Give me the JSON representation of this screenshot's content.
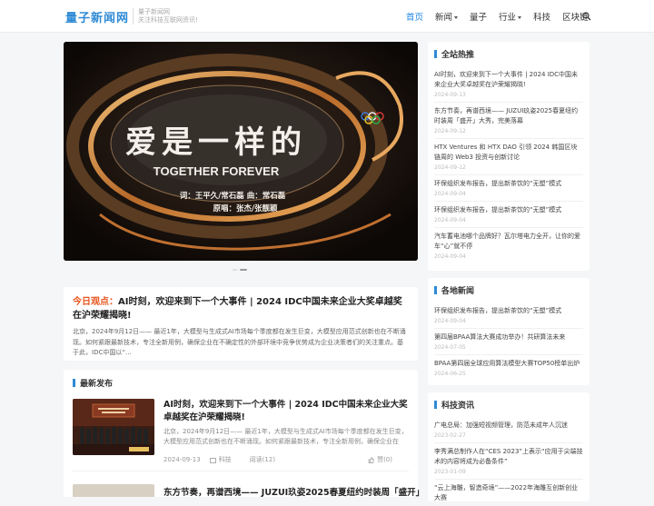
{
  "header": {
    "logo": "量子新闻网",
    "tagline_1": "量子新闻网",
    "tagline_2": "关注科技互联网资讯!",
    "nav": [
      {
        "label": "首页",
        "active": true,
        "dropdown": false
      },
      {
        "label": "新闻",
        "active": false,
        "dropdown": true
      },
      {
        "label": "量子",
        "active": false,
        "dropdown": false
      },
      {
        "label": "行业",
        "active": false,
        "dropdown": true
      },
      {
        "label": "科技",
        "active": false,
        "dropdown": false
      },
      {
        "label": "区块链",
        "active": false,
        "dropdown": false
      }
    ],
    "search_icon": "search-icon"
  },
  "slider": {
    "headline": "爱是一样的",
    "subtitle": "TOGETHER FOREVER",
    "credit_1": "词：王平久/常石磊    曲：常石磊",
    "credit_2": "原唱：张杰/张靓颖",
    "active_slide": 2,
    "slide_count": 2
  },
  "featured": {
    "prefix": "今日观点：",
    "title": "AI时刻，欢迎来到下一个大事件 | 2024 IDC中国未来企业大奖卓越奖在沪荣耀揭晓!",
    "excerpt": "北京，2024年9月12日—— 最近1年，大模型与生成式AI市场每个季度都在发生巨变，大模型应用范式创新也在不断涌现。如何紧跟最新技术，专注全新用例，确保企业在不确定性的外部环境中竞争优势成为企业决策者们的关注重点。基于此，IDC中国以“..."
  },
  "latest": {
    "heading": "最新发布",
    "items": [
      {
        "title": "AI时刻，欢迎来到下一个大事件 | 2024 IDC中国未来企业大奖卓越奖在沪荣耀揭晓!",
        "excerpt": "北京，2024年9月12日—— 最近1年，大模型与生成式AI市场每个季度都在发生巨变，大模型应用范式创新也在不断涌现。如何紧跟最新技术，专注全新用例，确保企业在不...",
        "date": "2024-09-13",
        "category": "科技",
        "views": "阅读(12)",
        "likes": "赞(0)"
      }
    ],
    "next_title": "东方节奏，再谱西境—— JUZUI玖姿2025春夏纽约时装周「盛开」"
  },
  "hot": {
    "heading": "全站热推",
    "items": [
      {
        "title": "AI时刻，欢迎来到下一个大事件 | 2024 IDC中国未来企业大奖卓越奖在沪荣耀揭晓!",
        "date": "2024-09-13"
      },
      {
        "title": "东方节奏，再谱西境—— JUZUI玖姿2025春夏纽约时装周「盛开」大秀，完美落幕",
        "date": "2024-09-12"
      },
      {
        "title": "HTX Ventures 和 HTX DAO 引领 2024 韩国区块链周的 Web3 投资与创新讨论",
        "date": "2024-09-12"
      },
      {
        "title": "环保组织发布报告，提出新茶饮的“无塑”模式",
        "date": "2024-09-04"
      },
      {
        "title": "环保组织发布报告，提出新茶饮的“无塑”模式",
        "date": "2024-09-04"
      },
      {
        "title": "汽车蓄电池哪个品牌好？瓦尔塔电力全开，让你的爱车“心”就不停",
        "date": "2024-09-04"
      }
    ]
  },
  "local": {
    "heading": "各地新闻",
    "items": [
      {
        "title": "环保组织发布报告，提出新茶饮的“无塑”模式",
        "date": "2024-09-04"
      },
      {
        "title": "第四届BPAA算法大赛成功举办！共研算法未来",
        "date": "2024-07-05"
      },
      {
        "title": "BPAA第四届全球应用算法模型大赛TOP50榜单出炉",
        "date": "2024-06-25"
      }
    ]
  },
  "tech": {
    "heading": "科技资讯",
    "items": [
      {
        "title": "广电总局：加强短视频管理，防范未成年人沉迷",
        "date": "2023-02-27"
      },
      {
        "title": "李秀满总制作人在“CES 2023”上表示“应用于尖端技术的内容将成为必备条件”",
        "date": "2023-01-09"
      },
      {
        "title": "“云上海雕，智造奇境”——2022年海雕互创新创业大赛",
        "date": ""
      }
    ]
  },
  "colors": {
    "accent": "#2e8ad6",
    "nav_active": "#1e88e5",
    "highlight": "#e8541c"
  }
}
